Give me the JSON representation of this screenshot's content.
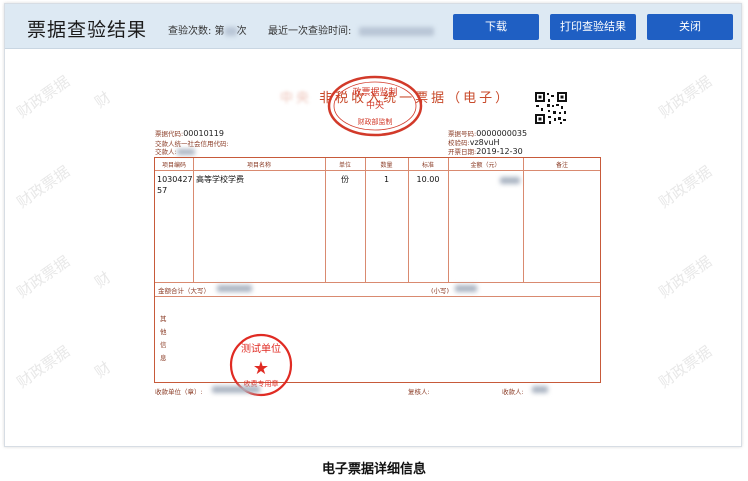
{
  "header": {
    "title": "票据查验结果",
    "count_label": "查验次数: 第",
    "count_suffix": "次",
    "last_check_label": "最近一次查验时间:",
    "buttons": {
      "download": "下载",
      "print": "打印查验结果",
      "close": "关闭"
    }
  },
  "watermark": "财政票据",
  "invoice": {
    "title_main": "非税收入统一票据（电子）",
    "seal_top": "政票据监制",
    "seal_center": "中央",
    "seal_bottom": "财政部监制",
    "code_label": "票据代码:",
    "code_value": "00010119",
    "payer_id_label": "交款人统一社会信用代码:",
    "payer_label": "交款人:",
    "number_label": "票据号码:",
    "number_value": "0000000035",
    "check_label": "校验码:",
    "check_value": "vz8vuH",
    "date_label": "开票日期:",
    "date_value": "2019-12-30",
    "columns": [
      "项目编码",
      "项目名称",
      "单位",
      "数量",
      "标准",
      "金额（元）",
      "备注"
    ],
    "row": {
      "code": "103042757",
      "name": "高等学校学费",
      "unit": "份",
      "qty": "1",
      "std": "10.00"
    },
    "total_label": "金额合计（大写）",
    "total_small_label": "(小写)",
    "other_label": [
      "其",
      "他",
      "信",
      "息"
    ],
    "stamp_top": "测试单位",
    "stamp_star": "★",
    "stamp_bottom": "收费专用章",
    "receiver_label": "收款单位（章）:",
    "reviewer_label": "复核人:",
    "collector_label": "收款人:"
  },
  "caption": "电子票据详细信息"
}
